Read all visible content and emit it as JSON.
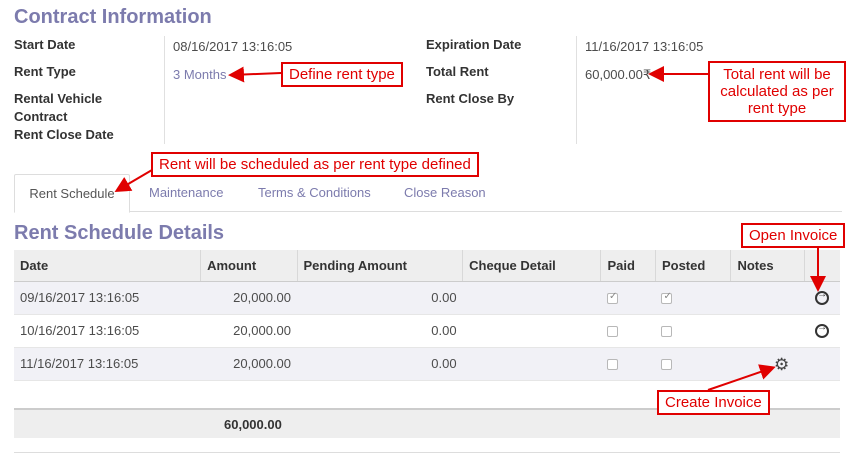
{
  "contract": {
    "title": "Contract Information",
    "start_date_label": "Start Date",
    "start_date_value": "08/16/2017 13:16:05",
    "rent_type_label": "Rent Type",
    "rent_type_value": "3 Months",
    "rental_vehicle_label": "Rental Vehicle Contract",
    "rent_close_date_label": "Rent Close Date",
    "expiration_date_label": "Expiration Date",
    "expiration_date_value": "11/16/2017 13:16:05",
    "total_rent_label": "Total Rent",
    "total_rent_value": "60,000.00₹",
    "rent_close_by_label": "Rent Close By"
  },
  "tabs": [
    "Rent Schedule",
    "Maintenance",
    "Terms & Conditions",
    "Close Reason"
  ],
  "schedule": {
    "title": "Rent Schedule Details",
    "columns": [
      "Date",
      "Amount",
      "Pending Amount",
      "Cheque Detail",
      "Paid",
      "Posted",
      "Notes"
    ],
    "rows": [
      {
        "date": "09/16/2017 13:16:05",
        "amount": "20,000.00",
        "pending": "0.00",
        "paid": true,
        "posted": true,
        "action": "open-invoice"
      },
      {
        "date": "10/16/2017 13:16:05",
        "amount": "20,000.00",
        "pending": "0.00",
        "paid": false,
        "posted": false,
        "action": "open-invoice"
      },
      {
        "date": "11/16/2017 13:16:05",
        "amount": "20,000.00",
        "pending": "0.00",
        "paid": false,
        "posted": false,
        "action": "create-invoice"
      }
    ],
    "total": "60,000.00"
  },
  "annotations": {
    "define_rent_type": "Define rent type",
    "total_rent_note": "Total rent will be calculated as per rent type",
    "rent_schedule_note": "Rent will be scheduled as per rent type defined",
    "open_invoice": "Open Invoice",
    "create_invoice": "Create Invoice"
  },
  "colors": {
    "accent": "#7c7bad",
    "annotation": "#e00000",
    "header_bg": "#eeeeee"
  }
}
